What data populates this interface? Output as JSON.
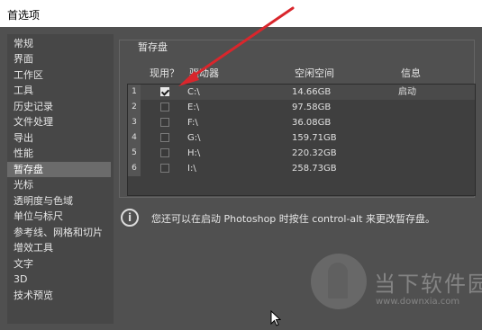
{
  "window": {
    "title": "首选项"
  },
  "sidebar": {
    "items": [
      {
        "label": "常规"
      },
      {
        "label": "界面"
      },
      {
        "label": "工作区"
      },
      {
        "label": "工具"
      },
      {
        "label": "历史记录"
      },
      {
        "label": "文件处理"
      },
      {
        "label": "导出"
      },
      {
        "label": "性能"
      },
      {
        "label": "暂存盘",
        "selected": true
      },
      {
        "label": "光标"
      },
      {
        "label": "透明度与色域"
      },
      {
        "label": "单位与标尺"
      },
      {
        "label": "参考线、网格和切片"
      },
      {
        "label": "增效工具"
      },
      {
        "label": "文字"
      },
      {
        "label": "3D"
      },
      {
        "label": "技术预览"
      }
    ]
  },
  "scratch": {
    "group_title": "暂存盘",
    "columns": {
      "active": "现用？",
      "drive": "驱动器",
      "free": "空闲空间",
      "info": "信息"
    },
    "rows": [
      {
        "num": "1",
        "checked": true,
        "drive": "C:\\",
        "free": "14.66GB",
        "info": "启动"
      },
      {
        "num": "2",
        "checked": false,
        "drive": "E:\\",
        "free": "97.58GB",
        "info": ""
      },
      {
        "num": "3",
        "checked": false,
        "drive": "F:\\",
        "free": "36.08GB",
        "info": ""
      },
      {
        "num": "4",
        "checked": false,
        "drive": "G:\\",
        "free": "159.71GB",
        "info": ""
      },
      {
        "num": "5",
        "checked": false,
        "drive": "H:\\",
        "free": "220.32GB",
        "info": ""
      },
      {
        "num": "6",
        "checked": false,
        "drive": "I:\\",
        "free": "258.73GB",
        "info": ""
      }
    ],
    "info_icon": "i",
    "info_text": "您还可以在启动 Photoshop 时按住 control-alt 来更改暂存盘。"
  },
  "watermark": {
    "title": "当下软件园",
    "url": "www.downxia.com"
  },
  "colors": {
    "arrow": "#d9262c",
    "selected": "#6b6b6b",
    "background": "#505050"
  }
}
